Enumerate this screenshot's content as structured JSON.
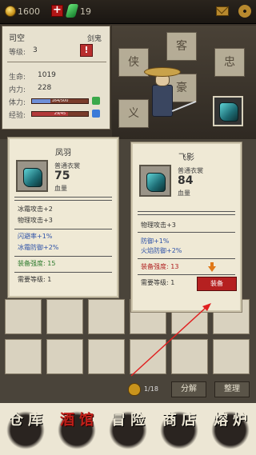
{
  "topbar": {
    "gold": "1600",
    "add_label": "+",
    "jade": "19"
  },
  "character": {
    "name": "司空",
    "class": "剑鬼",
    "level_label": "等级:",
    "level": "3",
    "alert": "!",
    "stats": [
      {
        "label": "生命:",
        "value": "1019"
      },
      {
        "label": "内力:",
        "value": "228"
      }
    ],
    "bars": [
      {
        "label": "体力:",
        "text": "164/500",
        "fraction": 0.33,
        "color": "#6e8fd8"
      },
      {
        "label": "经验:",
        "text": "29/45",
        "fraction": 0.64,
        "color": "#b33a3a"
      }
    ]
  },
  "scene": {
    "tiles": [
      "侠",
      "客",
      "忠",
      "义",
      "豪"
    ]
  },
  "card_current": {
    "title": "凤羽",
    "type": "普通衣裳",
    "value": "75",
    "unit": "血量",
    "lines": [
      {
        "text": "冰霜攻击+2",
        "tone": ""
      },
      {
        "text": "物理攻击+3",
        "tone": ""
      },
      {
        "text": "闪避率+1%",
        "tone": "blue"
      },
      {
        "text": "冰霜防御+2%",
        "tone": "blue"
      },
      {
        "text": "装备强度: 15",
        "tone": "green"
      },
      {
        "text": "需要等级: 1",
        "tone": ""
      }
    ]
  },
  "card_new": {
    "title": "飞影",
    "type": "普通衣裳",
    "value": "84",
    "unit": "血量",
    "lines": [
      {
        "text": "物理攻击+3",
        "tone": ""
      },
      {
        "text": "防御+1%",
        "tone": "blue"
      },
      {
        "text": "火焰防御+2%",
        "tone": "blue"
      },
      {
        "text": "装备强度: 13",
        "tone": "red"
      },
      {
        "text": "需要等级: 1",
        "tone": ""
      }
    ],
    "equip_label": "装备"
  },
  "inventory": {
    "count": "1/18",
    "decompose_label": "分解",
    "sort_label": "整理"
  },
  "nav": [
    {
      "label": "仓库",
      "active": false
    },
    {
      "label": "酒馆",
      "active": true
    },
    {
      "label": "冒险",
      "active": false
    },
    {
      "label": "商店",
      "active": false
    },
    {
      "label": "熔炉",
      "active": false
    }
  ],
  "colors": {
    "accent_red": "#b52020",
    "panel": "#efe9d5",
    "annotation": "#e02020"
  }
}
